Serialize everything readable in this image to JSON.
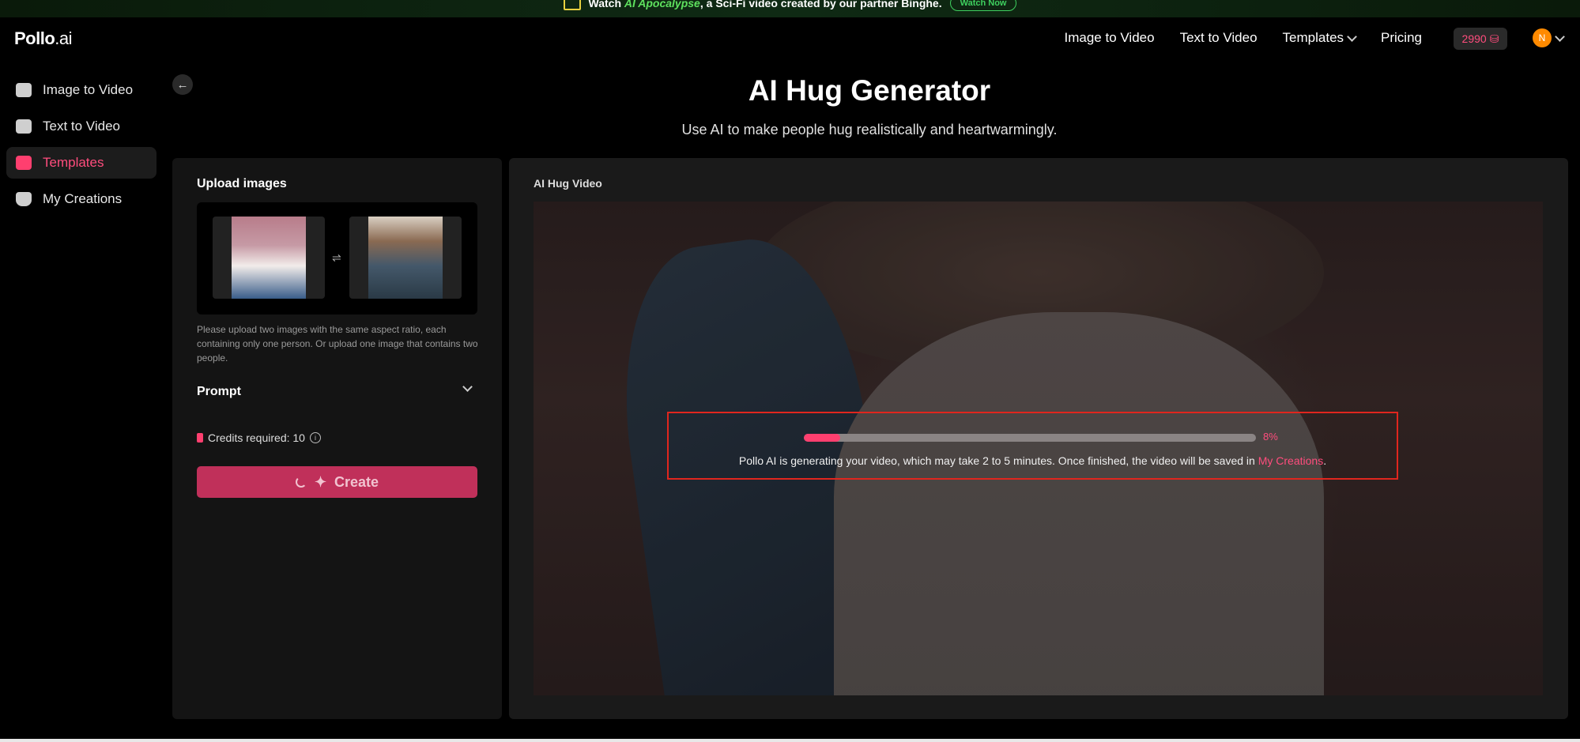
{
  "banner": {
    "prefix": "Watch ",
    "title": "AI Apocalypse",
    "suffix": ", a Sci-Fi video created by our partner Binghe.",
    "cta": "Watch Now"
  },
  "brand": {
    "logo_main": "Pollo",
    "logo_suffix": ".ai"
  },
  "topnav": {
    "links": [
      "Image to Video",
      "Text to Video",
      "Templates",
      "Pricing"
    ],
    "credits": "2990",
    "avatar_initial": "N"
  },
  "sidebar": {
    "items": [
      {
        "label": "Image to Video",
        "icon": "image-video-icon",
        "active": false
      },
      {
        "label": "Text to Video",
        "icon": "text-video-icon",
        "active": false
      },
      {
        "label": "Templates",
        "icon": "templates-icon",
        "active": true
      },
      {
        "label": "My Creations",
        "icon": "creations-icon",
        "active": false
      }
    ]
  },
  "page": {
    "title": "AI Hug Generator",
    "subtitle": "Use AI to make people hug realistically and heartwarmingly."
  },
  "left_panel": {
    "upload_title": "Upload images",
    "hint": "Please upload two images with the same aspect ratio, each containing only one person. Or upload one image that contains two people.",
    "prompt_label": "Prompt",
    "credits_label": "Credits required: 10",
    "create_label": "Create"
  },
  "right_panel": {
    "title": "AI Hug Video",
    "progress_percent": 8,
    "progress_label": "8%",
    "message_prefix": "Pollo AI is generating your video, which may take 2 to 5 minutes. Once finished, the video will be saved in ",
    "message_link": "My Creations",
    "message_suffix": "."
  },
  "colors": {
    "accent": "#ff4d7d",
    "create_button": "#c0305a",
    "highlight_border": "#e0261e",
    "banner_green": "#3fcf5f"
  }
}
